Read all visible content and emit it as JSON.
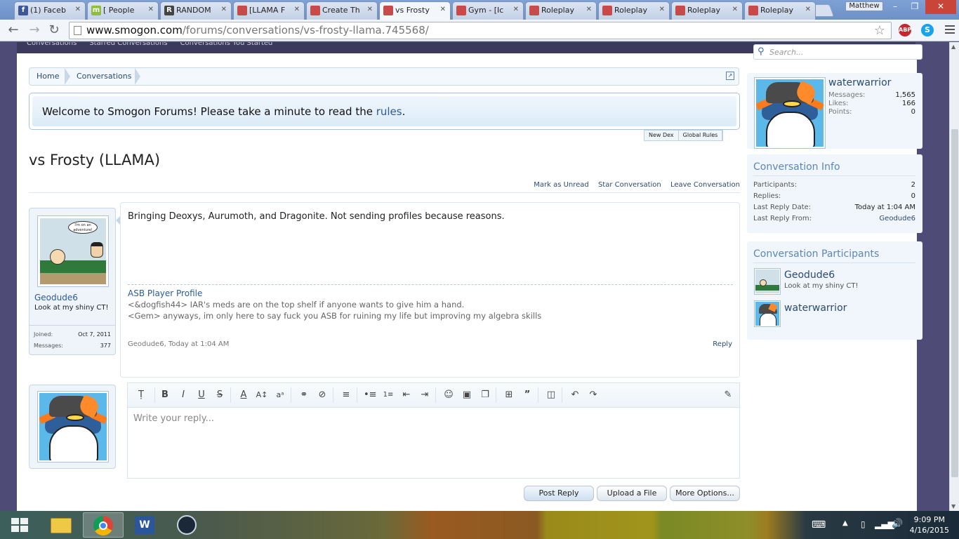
{
  "browser": {
    "tabs": [
      {
        "label": "(1) Faceb",
        "icon": "facebook-icon",
        "icon_char": "f",
        "icon_color": "#3b5998"
      },
      {
        "label": "[ People",
        "icon": "m-site-icon",
        "icon_char": "m",
        "icon_color": "#8fbf3a"
      },
      {
        "label": "RANDOM",
        "icon": "r-site-icon",
        "icon_char": "R",
        "icon_color": "#444444"
      },
      {
        "label": "[LLAMA F",
        "icon": "smogon-icon",
        "icon_char": "",
        "icon_color": "#c84b4b"
      },
      {
        "label": "Create Th",
        "icon": "smogon-icon",
        "icon_char": "",
        "icon_color": "#c84b4b"
      },
      {
        "label": "vs Frosty",
        "icon": "smogon-icon",
        "icon_char": "",
        "icon_color": "#c84b4b"
      },
      {
        "label": "Gym - [Ic",
        "icon": "smogon-icon",
        "icon_char": "",
        "icon_color": "#c84b4b"
      },
      {
        "label": "Roleplay",
        "icon": "smogon-icon",
        "icon_char": "",
        "icon_color": "#c84b4b"
      },
      {
        "label": "Roleplay",
        "icon": "smogon-icon",
        "icon_char": "",
        "icon_color": "#c84b4b"
      },
      {
        "label": "Roleplay",
        "icon": "smogon-icon",
        "icon_char": "",
        "icon_color": "#c84b4b"
      },
      {
        "label": "Roleplay",
        "icon": "smogon-icon",
        "icon_char": "",
        "icon_color": "#c84b4b"
      }
    ],
    "active_tab_index": 5,
    "user_label": "Matthew",
    "url_domain": "www.smogon.com",
    "url_path": "/forums/conversations/vs-frosty-llama.745568/",
    "ext_abp": "ABP",
    "ext_skype": "S"
  },
  "site_nav": {
    "items": [
      "Conversations",
      "Starred Conversations",
      "Conversations You Started"
    ]
  },
  "breadcrumbs": [
    "Home",
    "Conversations"
  ],
  "notice": {
    "text": "Welcome to Smogon Forums! Please take a minute to read the ",
    "link": "rules",
    "end": "."
  },
  "fun_links": [
    "New Dex",
    "Global Rules"
  ],
  "page_title": "vs Frosty (LLAMA)",
  "conv_actions": [
    "Mark as Unread",
    "Star Conversation",
    "Leave Conversation"
  ],
  "message": {
    "username": "Geodude6",
    "user_title": "Look at my shiny CT!",
    "joined_label": "Joined:",
    "joined": "Oct 7, 2011",
    "messages_label": "Messages:",
    "messages": "377",
    "avatar_bubble": "I'm on an adventure!",
    "text": "Bringing Deoxys, Aurumoth, and Dragonite. Not sending profiles because reasons.",
    "sig_title": "ASB Player Profile",
    "sig_lines": [
      "<&dogfish44> IAR's meds are on the top shelf if anyone wants to give him a hand.",
      "<Gem> anyways, im only here to say fuck you ASB for ruining my life but improving my algebra skills"
    ],
    "meta": "Geodude6, Today at 1:04 AM",
    "reply_label": "Reply"
  },
  "editor": {
    "placeholder": "Write your reply...",
    "post_label": "Post Reply",
    "upload_label": "Upload a File",
    "more_label": "More Options..."
  },
  "sidebar": {
    "search_placeholder": "Search...",
    "visitor": {
      "name": "waterwarrior",
      "stats": [
        {
          "label": "Messages:",
          "value": "1,565"
        },
        {
          "label": "Likes:",
          "value": "166"
        },
        {
          "label": "Points:",
          "value": "0"
        }
      ]
    },
    "info": {
      "heading": "Conversation Info",
      "rows": [
        {
          "label": "Participants:",
          "value": "2"
        },
        {
          "label": "Replies:",
          "value": "0"
        },
        {
          "label": "Last Reply Date:",
          "value": "Today at 1:04 AM"
        },
        {
          "label": "Last Reply From:",
          "value": "Geodude6"
        }
      ]
    },
    "participants": {
      "heading": "Conversation Participants",
      "list": [
        {
          "name": "Geodude6",
          "title": "Look at my shiny CT!"
        },
        {
          "name": "waterwarrior",
          "title": ""
        }
      ]
    }
  },
  "taskbar": {
    "time": "9:09 PM",
    "date": "4/16/2015"
  },
  "colors": {
    "accent": "#2b5aa0",
    "page_bg": "#4e4c76",
    "sidebar_bg": "#f0f6fb"
  }
}
